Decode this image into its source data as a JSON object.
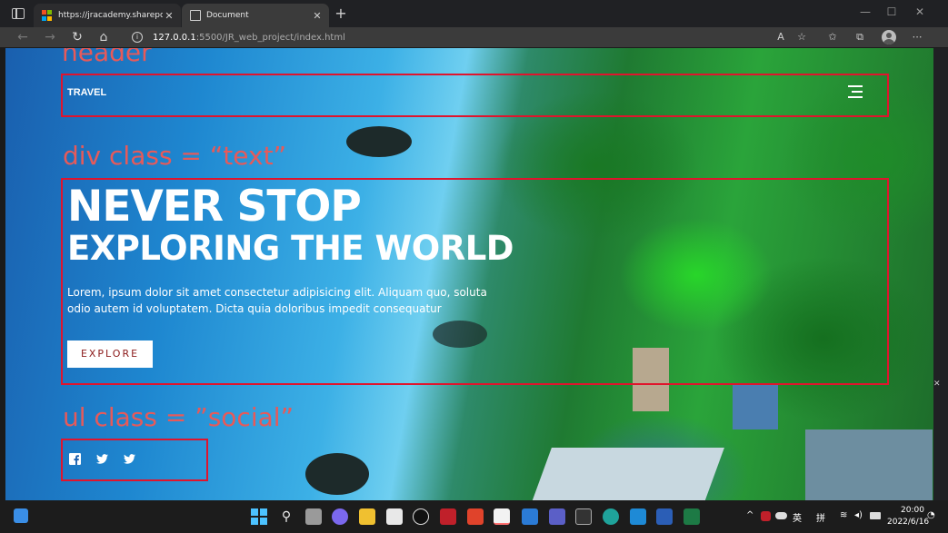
{
  "browser": {
    "tabs": [
      {
        "title": "https://jracademy.sharepoint.com"
      },
      {
        "title": "Document"
      }
    ],
    "new_tab": "+",
    "url_host": "127.0.0.1",
    "url_path": ":5500/JR_web_project/index.html",
    "window_controls": {
      "minimize": "—",
      "maximize": "☐",
      "close": "✕"
    }
  },
  "annotations": {
    "header": "header",
    "text": "div class = “text”",
    "social": "ul class = ”social”"
  },
  "page": {
    "logo": "TRAVEL",
    "hero_title": "NEVER STOP",
    "hero_subtitle": "EXPLORING THE WORLD",
    "hero_paragraph": "Lorem, ipsum dolor sit amet consectetur adipisicing elit. Aliquam quo, soluta odio autem id voluptatem. Dicta quia doloribus impedit consequatur",
    "explore_label": "EXPLORE",
    "social_icons": [
      "facebook-icon",
      "twitter-icon",
      "twitter-icon"
    ]
  },
  "taskbar": {
    "ime_lang": "英",
    "ime_mode": "拼",
    "time": "20:00",
    "date": "2022/6/16"
  },
  "colors": {
    "annotation_red": "#e0142d",
    "explore_text": "#8b1a1a"
  }
}
